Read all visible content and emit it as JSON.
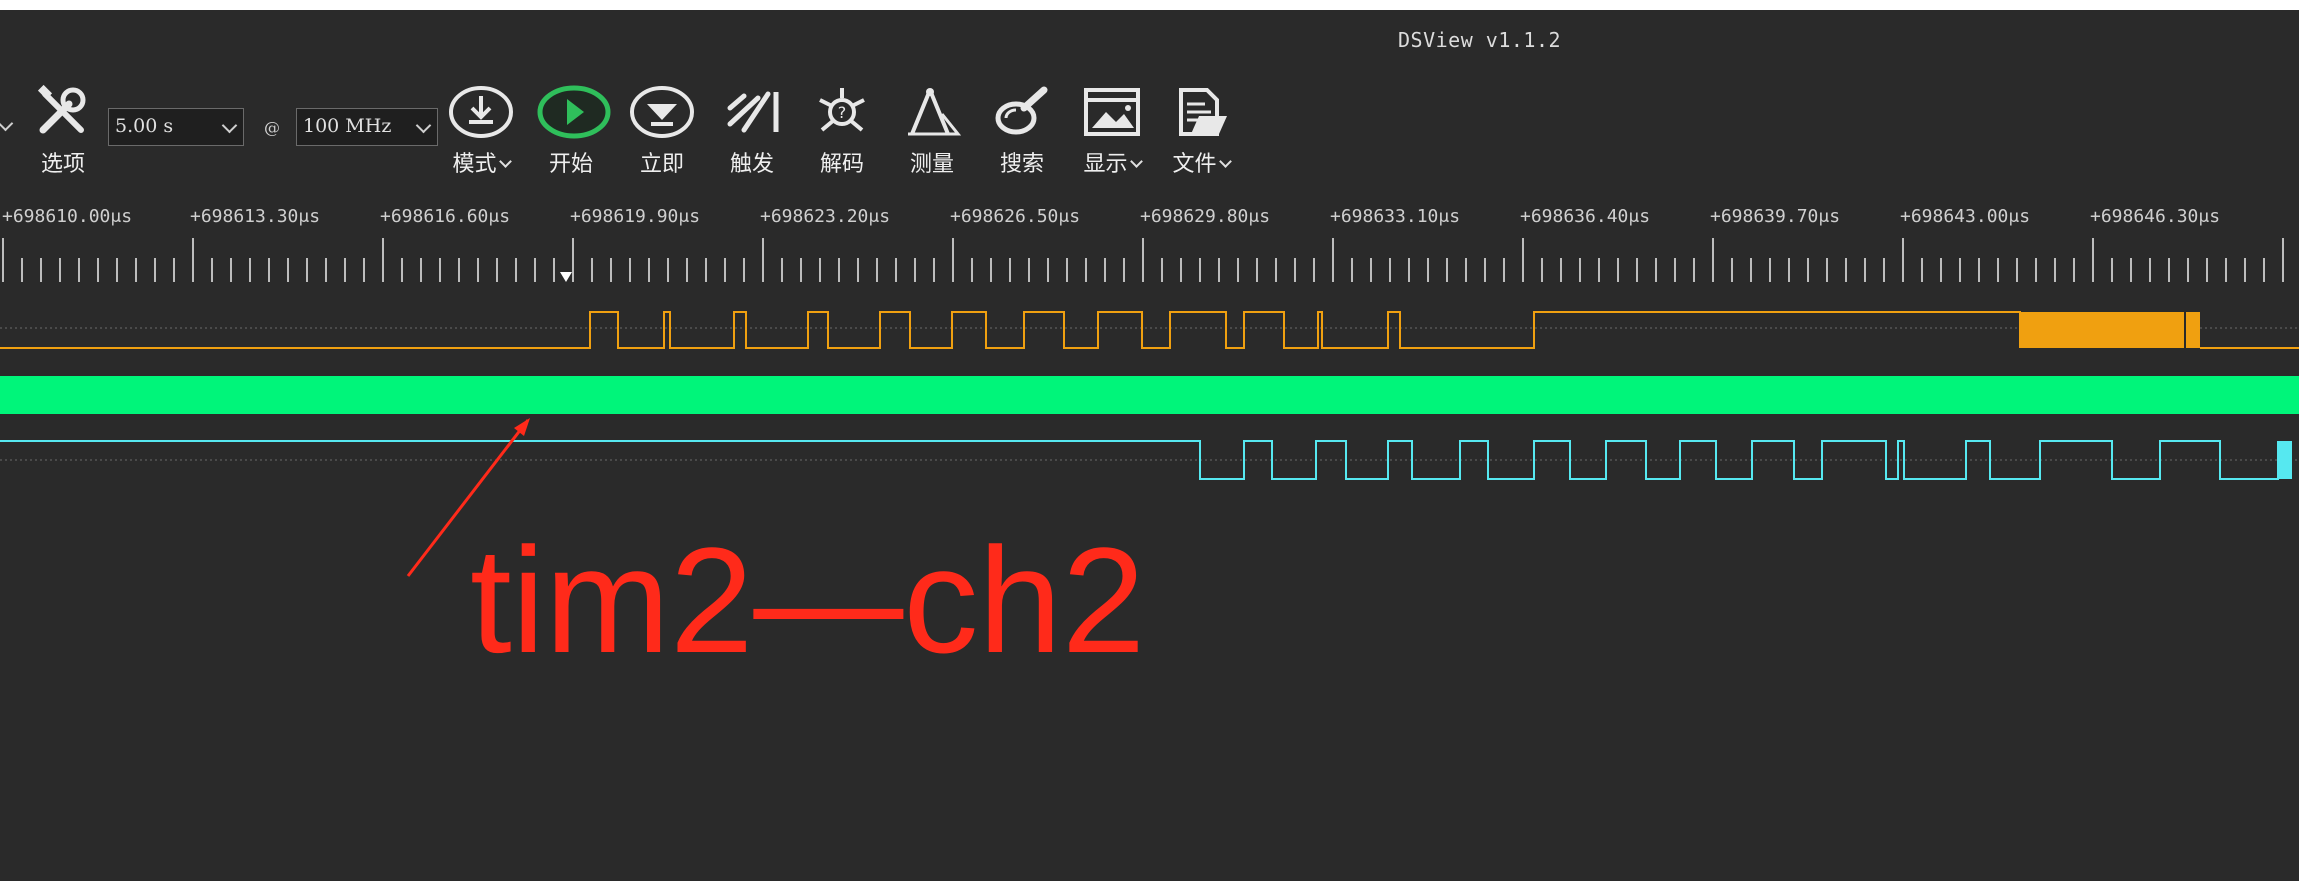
{
  "app_title": "DSView v1.1.2",
  "toolbar": {
    "options_label": "选项",
    "duration": "5.00 s",
    "at": "@",
    "samplerate": "100 MHz",
    "buttons": [
      {
        "icon": "download-icon",
        "label": "模式",
        "has_menu": true
      },
      {
        "icon": "play-icon",
        "label": "开始",
        "has_menu": false
      },
      {
        "icon": "instant-icon",
        "label": "立即",
        "has_menu": false
      },
      {
        "icon": "trigger-icon",
        "label": "触发",
        "has_menu": false
      },
      {
        "icon": "decode-icon",
        "label": "解码",
        "has_menu": false
      },
      {
        "icon": "measure-icon",
        "label": "测量",
        "has_menu": false
      },
      {
        "icon": "search-icon",
        "label": "搜索",
        "has_menu": false
      },
      {
        "icon": "display-icon",
        "label": "显示",
        "has_menu": true
      },
      {
        "icon": "file-icon",
        "label": "文件",
        "has_menu": true
      }
    ],
    "accent_play": "#2fbf5b"
  },
  "ruler": {
    "labels": [
      "+698610.00μs",
      "+698613.30μs",
      "+698616.60μs",
      "+698619.90μs",
      "+698623.20μs",
      "+698626.50μs",
      "+698629.80μs",
      "+698633.10μs",
      "+698636.40μs",
      "+698639.70μs",
      "+698643.00μs",
      "+698646.30μs"
    ]
  },
  "channels": {
    "ch1_color": "#f0a010",
    "ch2_color": "#00f57a",
    "ch3_color": "#56e8f0"
  },
  "annotation": {
    "text": "tim2—ch2",
    "color": "#ff2a1a"
  }
}
